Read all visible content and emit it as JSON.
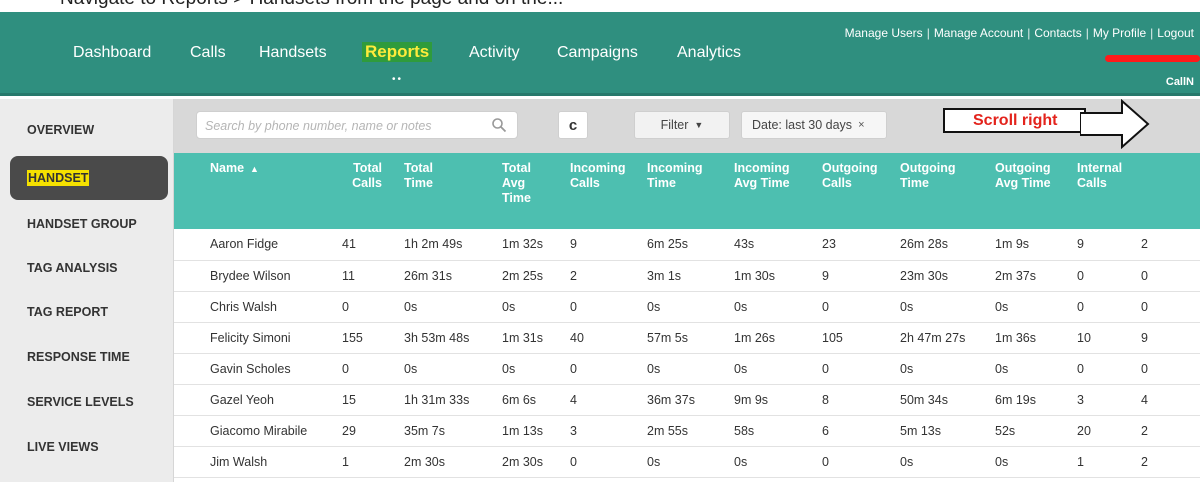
{
  "instruction": "Navigate to Reports > Handsets from the page and on the...",
  "nav": {
    "items": [
      "Dashboard",
      "Calls",
      "Handsets",
      "Reports",
      "Activity",
      "Campaigns",
      "Analytics"
    ],
    "active": "Reports",
    "dots": "••"
  },
  "user_links": [
    "Manage Users",
    "Manage Account",
    "Contacts",
    "My Profile",
    "Logout"
  ],
  "company_name": "CallN",
  "sidebar": {
    "items": [
      "OVERVIEW",
      "HANDSET",
      "HANDSET GROUP",
      "TAG ANALYSIS",
      "TAG REPORT",
      "RESPONSE TIME",
      "SERVICE LEVELS",
      "LIVE VIEWS"
    ],
    "active": "HANDSET"
  },
  "toolbar": {
    "search_placeholder": "Search by phone number, name or notes",
    "refresh_label": "c",
    "filter_label": "Filter",
    "filter_caret": "▼",
    "date_chip": "Date: last 30 days",
    "date_chip_close": "×"
  },
  "annotation": {
    "text": "Scroll right"
  },
  "table": {
    "sort_indicator": "▲",
    "headers": [
      [
        "Name"
      ],
      [
        "Total",
        "Calls"
      ],
      [
        "Total",
        "Time"
      ],
      [
        "Total",
        "Avg",
        "Time"
      ],
      [
        "Incoming",
        "Calls"
      ],
      [
        "Incoming",
        "Time"
      ],
      [
        "Incoming",
        "Avg Time"
      ],
      [
        "Outgoing",
        "Calls"
      ],
      [
        "Outgoing",
        "Time"
      ],
      [
        "Outgoing",
        "Avg Time"
      ],
      [
        "Internal",
        "Calls"
      ],
      [
        ""
      ]
    ],
    "rows": [
      [
        "Aaron Fidge",
        "41",
        "1h 2m 49s",
        "1m 32s",
        "9",
        "6m 25s",
        "43s",
        "23",
        "26m 28s",
        "1m 9s",
        "9",
        "2"
      ],
      [
        "Brydee Wilson",
        "11",
        "26m 31s",
        "2m 25s",
        "2",
        "3m 1s",
        "1m 30s",
        "9",
        "23m 30s",
        "2m 37s",
        "0",
        "0"
      ],
      [
        "Chris Walsh",
        "0",
        "0s",
        "0s",
        "0",
        "0s",
        "0s",
        "0",
        "0s",
        "0s",
        "0",
        "0"
      ],
      [
        "Felicity Simoni",
        "155",
        "3h 53m 48s",
        "1m 31s",
        "40",
        "57m 5s",
        "1m 26s",
        "105",
        "2h 47m 27s",
        "1m 36s",
        "10",
        "9"
      ],
      [
        "Gavin Scholes",
        "0",
        "0s",
        "0s",
        "0",
        "0s",
        "0s",
        "0",
        "0s",
        "0s",
        "0",
        "0"
      ],
      [
        "Gazel Yeoh",
        "15",
        "1h 31m 33s",
        "6m 6s",
        "4",
        "36m 37s",
        "9m 9s",
        "8",
        "50m 34s",
        "6m 19s",
        "3",
        "4"
      ],
      [
        "Giacomo Mirabile",
        "29",
        "35m 7s",
        "1m 13s",
        "3",
        "2m 55s",
        "58s",
        "6",
        "5m 13s",
        "52s",
        "20",
        "2"
      ],
      [
        "Jim Walsh",
        "1",
        "2m 30s",
        "2m 30s",
        "0",
        "0s",
        "0s",
        "0",
        "0s",
        "0s",
        "1",
        "2"
      ]
    ]
  },
  "colors": {
    "topbar": "#2f8f7f",
    "table_header": "#4dbfb0",
    "active_highlight": "#f5e100",
    "annotation_text": "#e3231c"
  }
}
